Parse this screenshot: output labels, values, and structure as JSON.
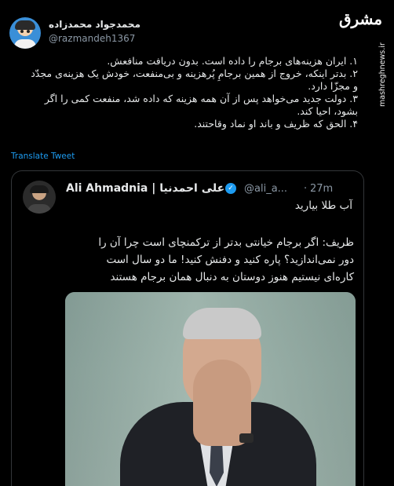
{
  "author": {
    "display_name": "محمدجواد محمدزاده",
    "handle": "@razmandeh1367"
  },
  "watermark": {
    "logo_text": "مشرق",
    "site_url": "mashreghnews.ir"
  },
  "tweet": {
    "lines": [
      "۱. ایران هزینه‌های برجام را داده است. بدون دریافت منافعش.",
      "۲. بدتر اینکه، خروج از همین برجامِ پُرهزینه و بی‌منفعت، خودش یک هزینه‌ی مجدّد",
      "و مجزّا دارد.",
      "۳. دولت جدید می‌خواهد پس از آن همه هزینه که داده شد، منفعت کمی را اگر",
      "بشود، احیا کند.",
      "۴. الحق که ظریف و باند او نماد وقاحتند."
    ],
    "translate_label": "Translate Tweet"
  },
  "quoted": {
    "name": "Ali Ahmadnia | علی احمدنیا",
    "handle": "@ali_a...",
    "time": "27m",
    "line1": "آب طلا بیارید",
    "body_lines": [
      "ظریف: اگر برجام خیانتی بدتر از ترکمنچای است چرا آن را",
      "دور نمی‌اندازید؟ پاره کنید و دفنش کنید! ما دو سال است",
      "کاره‌ای نیستیم هنوز دوستان به دنبال همان برجام هستند"
    ]
  }
}
